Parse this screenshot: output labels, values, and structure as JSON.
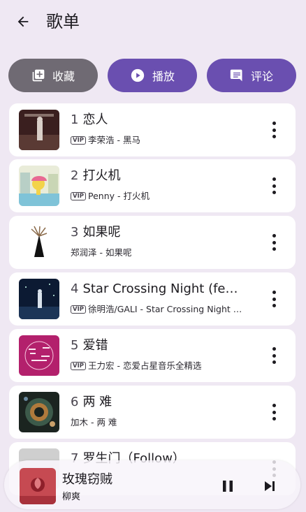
{
  "header": {
    "title": "歌单",
    "back_icon": "arrow-left-icon"
  },
  "actions": [
    {
      "label": "收藏",
      "icon": "playlist-add-icon",
      "color": "#6f6a73"
    },
    {
      "label": "播放",
      "icon": "play-circle-icon",
      "color": "#6a4fb0"
    },
    {
      "label": "评论",
      "icon": "comment-icon",
      "color": "#6a4fb0"
    }
  ],
  "songs": [
    {
      "num": "1",
      "title": "恋人",
      "vip": true,
      "subtitle": "李荣浩 - 黑马"
    },
    {
      "num": "2",
      "title": "打火机",
      "vip": true,
      "subtitle": "Penny - 打火机"
    },
    {
      "num": "3",
      "title": "如果呢",
      "vip": false,
      "subtitle": "郑润泽 - 如果呢"
    },
    {
      "num": "4",
      "title": "Star Crossing Night (feat. GALI)",
      "vip": true,
      "subtitle": "徐明浩/GALI - Star Crossing Night (feat. GALI)"
    },
    {
      "num": "5",
      "title": "爱错",
      "vip": true,
      "subtitle": "王力宏 - 恋爱占星音乐全精选"
    },
    {
      "num": "6",
      "title": "两 难",
      "vip": false,
      "subtitle": "加木 - 两 难"
    },
    {
      "num": "7",
      "title": "罗生门（Follow）",
      "vip": false,
      "subtitle": ""
    }
  ],
  "vip_label": "VIP",
  "player": {
    "title": "玫瑰窃贼",
    "artist": "柳爽",
    "pause_icon": "pause-icon",
    "next_icon": "skip-next-icon"
  },
  "colors": {
    "accent": "#6a4fb0",
    "secondary": "#6f6a73",
    "background": "#efe8f3"
  }
}
